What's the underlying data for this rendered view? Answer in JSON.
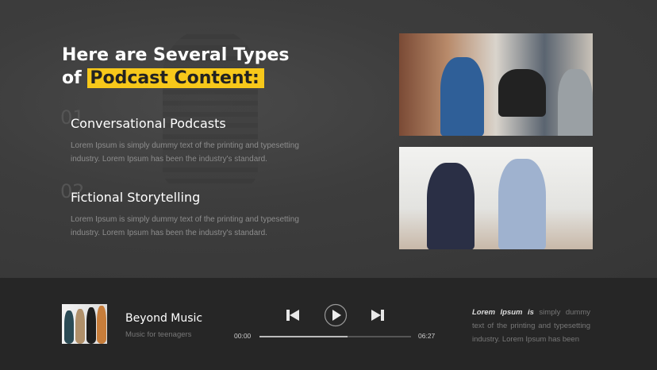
{
  "heading": {
    "line1": "Here are Several Types",
    "line2_prefix": "of",
    "line2_highlight": "Podcast Content:"
  },
  "sections": [
    {
      "number": "01",
      "title": "Conversational Podcasts",
      "line1": "Lorem Ipsum is simply dummy text of the printing and typesetting",
      "line2": "industry.  Lorem Ipsum has been the industry's standard."
    },
    {
      "number": "02",
      "title": "Fictional Storytelling",
      "line1": "Lorem Ipsum is simply dummy text of the printing and typesetting",
      "line2": "industry.  Lorem Ipsum has been the industry's standard."
    }
  ],
  "colors": {
    "accent": "#f7c81a",
    "background": "#3b3b3b",
    "player": "#262626"
  },
  "player": {
    "title": "Beyond Music",
    "subtitle": "Music for teenagers",
    "current_time": "00:00",
    "total_time": "06:27",
    "progress": 0.58,
    "icons": [
      "skip-back-icon",
      "play-icon",
      "skip-forward-icon"
    ],
    "description_bold": "Lorem Ipsum is",
    "description_rest": " simply dummy text of the printing and typesetting industry.  Lorem Ipsum has been"
  }
}
